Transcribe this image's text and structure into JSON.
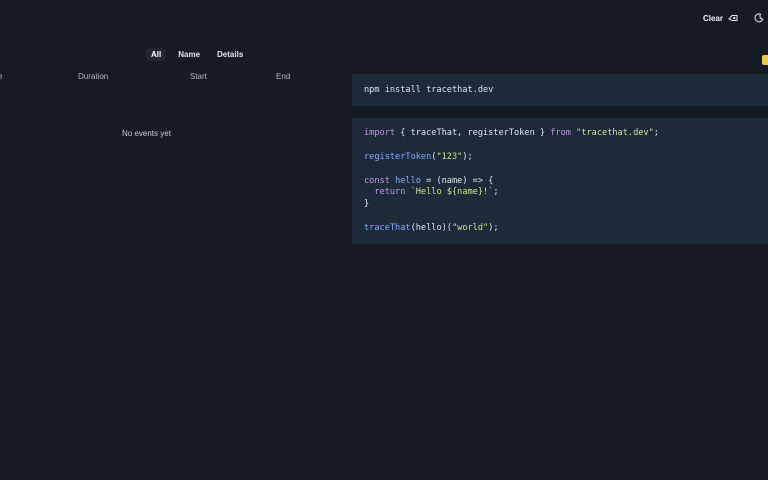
{
  "header": {
    "clear_label": "Clear"
  },
  "tabs": [
    {
      "label": "All",
      "active": true
    },
    {
      "label": "Name",
      "active": false
    },
    {
      "label": "Details",
      "active": false
    }
  ],
  "events_table": {
    "columns": [
      "e",
      "Duration",
      "Start",
      "End"
    ],
    "empty_message": "No events yet"
  },
  "install": {
    "command": "npm install tracethat.dev"
  },
  "snippet": {
    "line1": {
      "kw_import": "import",
      "braces": " { traceThat, registerToken } ",
      "kw_from": "from",
      "space": " ",
      "module": "\"tracethat.dev\"",
      "end": ";"
    },
    "line3": {
      "fn": "registerToken",
      "open": "(",
      "arg": "\"123\"",
      "close": ");"
    },
    "line5": {
      "kw_const": "const",
      "space": " ",
      "name": "hello",
      "rest": " = (name) => {"
    },
    "line6": {
      "indent": "  ",
      "kw_return": "return",
      "template": " `Hello ${name}!`",
      "end": ";"
    },
    "line7": {
      "text": "}"
    },
    "line9": {
      "fn": "traceThat",
      "mid": "(hello)(",
      "arg": "\"world\"",
      "end": ");"
    }
  },
  "colors": {
    "background": "#161b23",
    "code_panel": "#1c2a3a",
    "keyword": "#c792ea",
    "function": "#82aaff",
    "string": "#c3e88d",
    "badge": "#e9c94a"
  },
  "icons": {
    "clear": "eraser-icon",
    "theme": "moon-icon"
  }
}
